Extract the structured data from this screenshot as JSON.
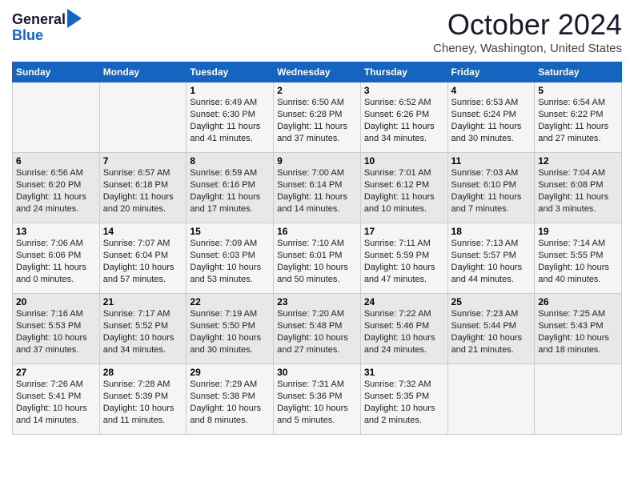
{
  "header": {
    "logo_line1": "General",
    "logo_line2": "Blue",
    "month": "October 2024",
    "location": "Cheney, Washington, United States"
  },
  "days_of_week": [
    "Sunday",
    "Monday",
    "Tuesday",
    "Wednesday",
    "Thursday",
    "Friday",
    "Saturday"
  ],
  "weeks": [
    [
      {
        "day": "",
        "info": ""
      },
      {
        "day": "",
        "info": ""
      },
      {
        "day": "1",
        "info": "Sunrise: 6:49 AM\nSunset: 6:30 PM\nDaylight: 11 hours and 41 minutes."
      },
      {
        "day": "2",
        "info": "Sunrise: 6:50 AM\nSunset: 6:28 PM\nDaylight: 11 hours and 37 minutes."
      },
      {
        "day": "3",
        "info": "Sunrise: 6:52 AM\nSunset: 6:26 PM\nDaylight: 11 hours and 34 minutes."
      },
      {
        "day": "4",
        "info": "Sunrise: 6:53 AM\nSunset: 6:24 PM\nDaylight: 11 hours and 30 minutes."
      },
      {
        "day": "5",
        "info": "Sunrise: 6:54 AM\nSunset: 6:22 PM\nDaylight: 11 hours and 27 minutes."
      }
    ],
    [
      {
        "day": "6",
        "info": "Sunrise: 6:56 AM\nSunset: 6:20 PM\nDaylight: 11 hours and 24 minutes."
      },
      {
        "day": "7",
        "info": "Sunrise: 6:57 AM\nSunset: 6:18 PM\nDaylight: 11 hours and 20 minutes."
      },
      {
        "day": "8",
        "info": "Sunrise: 6:59 AM\nSunset: 6:16 PM\nDaylight: 11 hours and 17 minutes."
      },
      {
        "day": "9",
        "info": "Sunrise: 7:00 AM\nSunset: 6:14 PM\nDaylight: 11 hours and 14 minutes."
      },
      {
        "day": "10",
        "info": "Sunrise: 7:01 AM\nSunset: 6:12 PM\nDaylight: 11 hours and 10 minutes."
      },
      {
        "day": "11",
        "info": "Sunrise: 7:03 AM\nSunset: 6:10 PM\nDaylight: 11 hours and 7 minutes."
      },
      {
        "day": "12",
        "info": "Sunrise: 7:04 AM\nSunset: 6:08 PM\nDaylight: 11 hours and 3 minutes."
      }
    ],
    [
      {
        "day": "13",
        "info": "Sunrise: 7:06 AM\nSunset: 6:06 PM\nDaylight: 11 hours and 0 minutes."
      },
      {
        "day": "14",
        "info": "Sunrise: 7:07 AM\nSunset: 6:04 PM\nDaylight: 10 hours and 57 minutes."
      },
      {
        "day": "15",
        "info": "Sunrise: 7:09 AM\nSunset: 6:03 PM\nDaylight: 10 hours and 53 minutes."
      },
      {
        "day": "16",
        "info": "Sunrise: 7:10 AM\nSunset: 6:01 PM\nDaylight: 10 hours and 50 minutes."
      },
      {
        "day": "17",
        "info": "Sunrise: 7:11 AM\nSunset: 5:59 PM\nDaylight: 10 hours and 47 minutes."
      },
      {
        "day": "18",
        "info": "Sunrise: 7:13 AM\nSunset: 5:57 PM\nDaylight: 10 hours and 44 minutes."
      },
      {
        "day": "19",
        "info": "Sunrise: 7:14 AM\nSunset: 5:55 PM\nDaylight: 10 hours and 40 minutes."
      }
    ],
    [
      {
        "day": "20",
        "info": "Sunrise: 7:16 AM\nSunset: 5:53 PM\nDaylight: 10 hours and 37 minutes."
      },
      {
        "day": "21",
        "info": "Sunrise: 7:17 AM\nSunset: 5:52 PM\nDaylight: 10 hours and 34 minutes."
      },
      {
        "day": "22",
        "info": "Sunrise: 7:19 AM\nSunset: 5:50 PM\nDaylight: 10 hours and 30 minutes."
      },
      {
        "day": "23",
        "info": "Sunrise: 7:20 AM\nSunset: 5:48 PM\nDaylight: 10 hours and 27 minutes."
      },
      {
        "day": "24",
        "info": "Sunrise: 7:22 AM\nSunset: 5:46 PM\nDaylight: 10 hours and 24 minutes."
      },
      {
        "day": "25",
        "info": "Sunrise: 7:23 AM\nSunset: 5:44 PM\nDaylight: 10 hours and 21 minutes."
      },
      {
        "day": "26",
        "info": "Sunrise: 7:25 AM\nSunset: 5:43 PM\nDaylight: 10 hours and 18 minutes."
      }
    ],
    [
      {
        "day": "27",
        "info": "Sunrise: 7:26 AM\nSunset: 5:41 PM\nDaylight: 10 hours and 14 minutes."
      },
      {
        "day": "28",
        "info": "Sunrise: 7:28 AM\nSunset: 5:39 PM\nDaylight: 10 hours and 11 minutes."
      },
      {
        "day": "29",
        "info": "Sunrise: 7:29 AM\nSunset: 5:38 PM\nDaylight: 10 hours and 8 minutes."
      },
      {
        "day": "30",
        "info": "Sunrise: 7:31 AM\nSunset: 5:36 PM\nDaylight: 10 hours and 5 minutes."
      },
      {
        "day": "31",
        "info": "Sunrise: 7:32 AM\nSunset: 5:35 PM\nDaylight: 10 hours and 2 minutes."
      },
      {
        "day": "",
        "info": ""
      },
      {
        "day": "",
        "info": ""
      }
    ]
  ]
}
